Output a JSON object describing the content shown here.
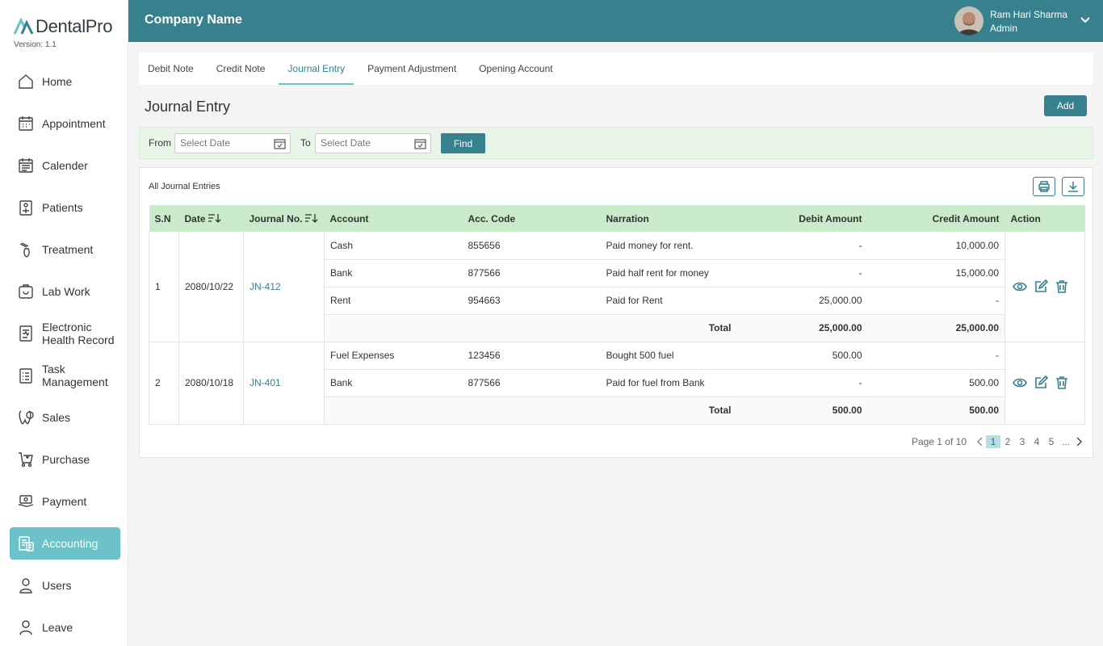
{
  "app": {
    "logo_text": "DentalPro",
    "version": "Version: 1.1"
  },
  "header": {
    "company": "Company Name",
    "user_name": "Ram Hari Sharma",
    "user_role": "Admin"
  },
  "sidebar": {
    "items": [
      {
        "label": "Home",
        "icon": "home-icon"
      },
      {
        "label": "Appointment",
        "icon": "appointment-icon"
      },
      {
        "label": "Calender",
        "icon": "calendar-icon"
      },
      {
        "label": "Patients",
        "icon": "patients-icon"
      },
      {
        "label": "Treatment",
        "icon": "treatment-icon"
      },
      {
        "label": "Lab Work",
        "icon": "lab-work-icon"
      },
      {
        "label": "Electronic Health Record",
        "icon": "health-record-icon"
      },
      {
        "label": "Task Management",
        "icon": "task-icon"
      },
      {
        "label": "Sales",
        "icon": "sales-icon"
      },
      {
        "label": "Purchase",
        "icon": "purchase-icon"
      },
      {
        "label": "Payment",
        "icon": "payment-icon"
      },
      {
        "label": "Accounting",
        "icon": "accounting-icon",
        "active": true
      },
      {
        "label": "Users",
        "icon": "users-icon"
      },
      {
        "label": "Leave",
        "icon": "leave-icon"
      }
    ]
  },
  "tabs": [
    "Debit Note",
    "Credit Note",
    "Journal Entry",
    "Payment Adjustment",
    "Opening Account"
  ],
  "active_tab": "Journal Entry",
  "page": {
    "title": "Journal Entry",
    "add_label": "Add"
  },
  "filter": {
    "from_label": "From",
    "to_label": "To",
    "from_placeholder": "Select Date",
    "to_placeholder": "Select Date",
    "find_label": "Find"
  },
  "card": {
    "title": "All Journal Entries"
  },
  "table": {
    "headers": [
      "S.N",
      "Date",
      "Journal No.",
      "Account",
      "Acc. Code",
      "Narration",
      "Debit Amount",
      "Credit Amount",
      "Action"
    ],
    "total_label": "Total",
    "entries": [
      {
        "sn": "1",
        "date": "2080/10/22",
        "journal_no": "JN-412",
        "lines": [
          {
            "account": "Cash",
            "code": "855656",
            "narration": "Paid money for rent.",
            "debit": "-",
            "credit": "10,000.00"
          },
          {
            "account": "Bank",
            "code": "877566",
            "narration": "Paid half rent for money",
            "debit": "-",
            "credit": "15,000.00"
          },
          {
            "account": "Rent",
            "code": "954663",
            "narration": "Paid for Rent",
            "debit": "25,000.00",
            "credit": "-"
          }
        ],
        "total_debit": "25,000.00",
        "total_credit": "25,000.00"
      },
      {
        "sn": "2",
        "date": "2080/10/18",
        "journal_no": "JN-401",
        "lines": [
          {
            "account": "Fuel Expenses",
            "code": "123456",
            "narration": "Bought 500 fuel",
            "debit": "500.00",
            "credit": "-"
          },
          {
            "account": "Bank",
            "code": "877566",
            "narration": "Paid for fuel from Bank",
            "debit": "-",
            "credit": "500.00"
          }
        ],
        "total_debit": "500.00",
        "total_credit": "500.00"
      }
    ]
  },
  "pagination": {
    "info": "Page 1 of 10",
    "pages": [
      "1",
      "2",
      "3",
      "4",
      "5",
      "..."
    ],
    "current": "1"
  },
  "colors": {
    "primary": "#37808d",
    "accent": "#6dc1c9",
    "table_header": "#c9ebcb",
    "filter_bg": "#e8f5e8"
  }
}
